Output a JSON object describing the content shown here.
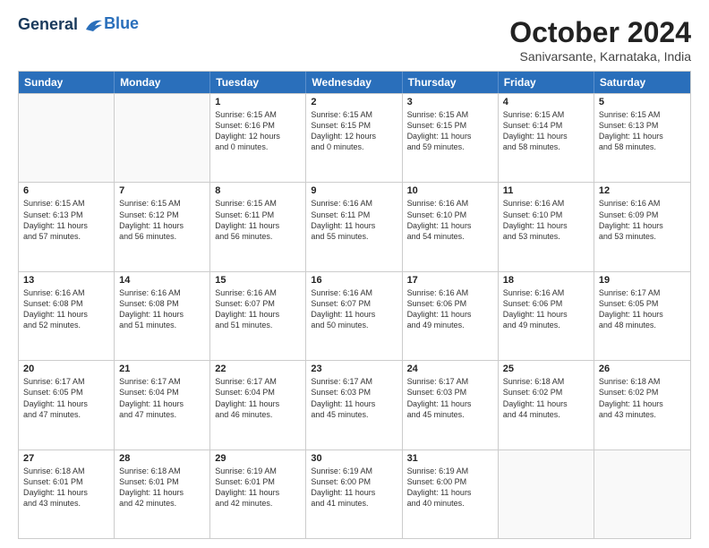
{
  "logo": {
    "line1": "General",
    "line2": "Blue"
  },
  "title": "October 2024",
  "subtitle": "Sanivarsante, Karnataka, India",
  "header_days": [
    "Sunday",
    "Monday",
    "Tuesday",
    "Wednesday",
    "Thursday",
    "Friday",
    "Saturday"
  ],
  "weeks": [
    [
      {
        "day": "",
        "lines": []
      },
      {
        "day": "",
        "lines": []
      },
      {
        "day": "1",
        "lines": [
          "Sunrise: 6:15 AM",
          "Sunset: 6:16 PM",
          "Daylight: 12 hours",
          "and 0 minutes."
        ]
      },
      {
        "day": "2",
        "lines": [
          "Sunrise: 6:15 AM",
          "Sunset: 6:15 PM",
          "Daylight: 12 hours",
          "and 0 minutes."
        ]
      },
      {
        "day": "3",
        "lines": [
          "Sunrise: 6:15 AM",
          "Sunset: 6:15 PM",
          "Daylight: 11 hours",
          "and 59 minutes."
        ]
      },
      {
        "day": "4",
        "lines": [
          "Sunrise: 6:15 AM",
          "Sunset: 6:14 PM",
          "Daylight: 11 hours",
          "and 58 minutes."
        ]
      },
      {
        "day": "5",
        "lines": [
          "Sunrise: 6:15 AM",
          "Sunset: 6:13 PM",
          "Daylight: 11 hours",
          "and 58 minutes."
        ]
      }
    ],
    [
      {
        "day": "6",
        "lines": [
          "Sunrise: 6:15 AM",
          "Sunset: 6:13 PM",
          "Daylight: 11 hours",
          "and 57 minutes."
        ]
      },
      {
        "day": "7",
        "lines": [
          "Sunrise: 6:15 AM",
          "Sunset: 6:12 PM",
          "Daylight: 11 hours",
          "and 56 minutes."
        ]
      },
      {
        "day": "8",
        "lines": [
          "Sunrise: 6:15 AM",
          "Sunset: 6:11 PM",
          "Daylight: 11 hours",
          "and 56 minutes."
        ]
      },
      {
        "day": "9",
        "lines": [
          "Sunrise: 6:16 AM",
          "Sunset: 6:11 PM",
          "Daylight: 11 hours",
          "and 55 minutes."
        ]
      },
      {
        "day": "10",
        "lines": [
          "Sunrise: 6:16 AM",
          "Sunset: 6:10 PM",
          "Daylight: 11 hours",
          "and 54 minutes."
        ]
      },
      {
        "day": "11",
        "lines": [
          "Sunrise: 6:16 AM",
          "Sunset: 6:10 PM",
          "Daylight: 11 hours",
          "and 53 minutes."
        ]
      },
      {
        "day": "12",
        "lines": [
          "Sunrise: 6:16 AM",
          "Sunset: 6:09 PM",
          "Daylight: 11 hours",
          "and 53 minutes."
        ]
      }
    ],
    [
      {
        "day": "13",
        "lines": [
          "Sunrise: 6:16 AM",
          "Sunset: 6:08 PM",
          "Daylight: 11 hours",
          "and 52 minutes."
        ]
      },
      {
        "day": "14",
        "lines": [
          "Sunrise: 6:16 AM",
          "Sunset: 6:08 PM",
          "Daylight: 11 hours",
          "and 51 minutes."
        ]
      },
      {
        "day": "15",
        "lines": [
          "Sunrise: 6:16 AM",
          "Sunset: 6:07 PM",
          "Daylight: 11 hours",
          "and 51 minutes."
        ]
      },
      {
        "day": "16",
        "lines": [
          "Sunrise: 6:16 AM",
          "Sunset: 6:07 PM",
          "Daylight: 11 hours",
          "and 50 minutes."
        ]
      },
      {
        "day": "17",
        "lines": [
          "Sunrise: 6:16 AM",
          "Sunset: 6:06 PM",
          "Daylight: 11 hours",
          "and 49 minutes."
        ]
      },
      {
        "day": "18",
        "lines": [
          "Sunrise: 6:16 AM",
          "Sunset: 6:06 PM",
          "Daylight: 11 hours",
          "and 49 minutes."
        ]
      },
      {
        "day": "19",
        "lines": [
          "Sunrise: 6:17 AM",
          "Sunset: 6:05 PM",
          "Daylight: 11 hours",
          "and 48 minutes."
        ]
      }
    ],
    [
      {
        "day": "20",
        "lines": [
          "Sunrise: 6:17 AM",
          "Sunset: 6:05 PM",
          "Daylight: 11 hours",
          "and 47 minutes."
        ]
      },
      {
        "day": "21",
        "lines": [
          "Sunrise: 6:17 AM",
          "Sunset: 6:04 PM",
          "Daylight: 11 hours",
          "and 47 minutes."
        ]
      },
      {
        "day": "22",
        "lines": [
          "Sunrise: 6:17 AM",
          "Sunset: 6:04 PM",
          "Daylight: 11 hours",
          "and 46 minutes."
        ]
      },
      {
        "day": "23",
        "lines": [
          "Sunrise: 6:17 AM",
          "Sunset: 6:03 PM",
          "Daylight: 11 hours",
          "and 45 minutes."
        ]
      },
      {
        "day": "24",
        "lines": [
          "Sunrise: 6:17 AM",
          "Sunset: 6:03 PM",
          "Daylight: 11 hours",
          "and 45 minutes."
        ]
      },
      {
        "day": "25",
        "lines": [
          "Sunrise: 6:18 AM",
          "Sunset: 6:02 PM",
          "Daylight: 11 hours",
          "and 44 minutes."
        ]
      },
      {
        "day": "26",
        "lines": [
          "Sunrise: 6:18 AM",
          "Sunset: 6:02 PM",
          "Daylight: 11 hours",
          "and 43 minutes."
        ]
      }
    ],
    [
      {
        "day": "27",
        "lines": [
          "Sunrise: 6:18 AM",
          "Sunset: 6:01 PM",
          "Daylight: 11 hours",
          "and 43 minutes."
        ]
      },
      {
        "day": "28",
        "lines": [
          "Sunrise: 6:18 AM",
          "Sunset: 6:01 PM",
          "Daylight: 11 hours",
          "and 42 minutes."
        ]
      },
      {
        "day": "29",
        "lines": [
          "Sunrise: 6:19 AM",
          "Sunset: 6:01 PM",
          "Daylight: 11 hours",
          "and 42 minutes."
        ]
      },
      {
        "day": "30",
        "lines": [
          "Sunrise: 6:19 AM",
          "Sunset: 6:00 PM",
          "Daylight: 11 hours",
          "and 41 minutes."
        ]
      },
      {
        "day": "31",
        "lines": [
          "Sunrise: 6:19 AM",
          "Sunset: 6:00 PM",
          "Daylight: 11 hours",
          "and 40 minutes."
        ]
      },
      {
        "day": "",
        "lines": []
      },
      {
        "day": "",
        "lines": []
      }
    ]
  ]
}
